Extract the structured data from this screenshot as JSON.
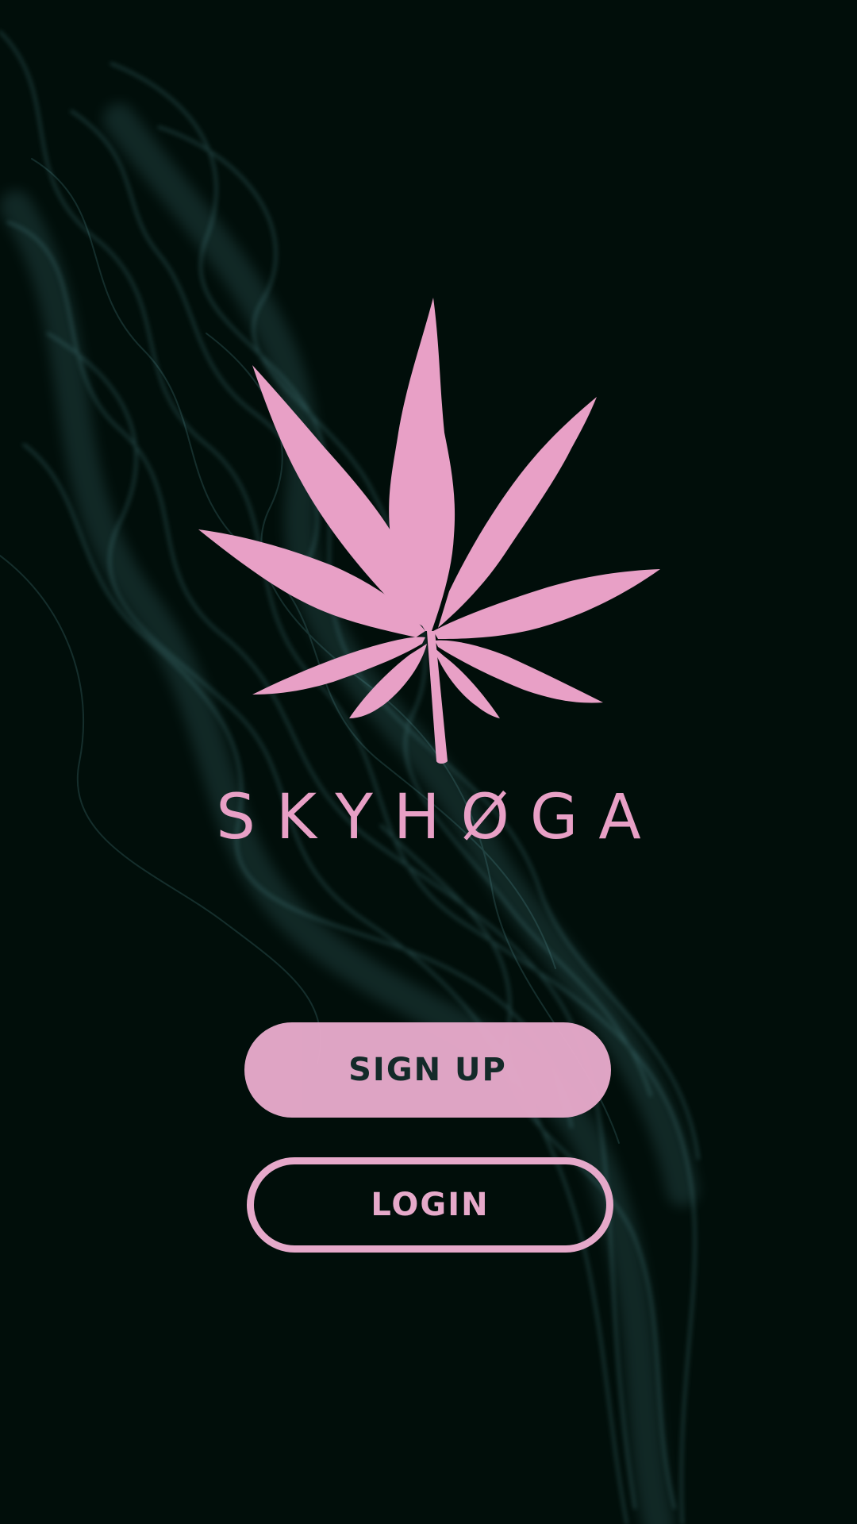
{
  "app": {
    "brand_name": "SKYHØGA"
  },
  "actions": {
    "signup_label": "SIGN UP",
    "login_label": "LOGIN"
  },
  "theme": {
    "background": "#010e0a",
    "accent": "#e6a9ca",
    "smoke": "#5c9ea3"
  },
  "icons": {
    "logo": "cannabis-leaf-icon"
  }
}
